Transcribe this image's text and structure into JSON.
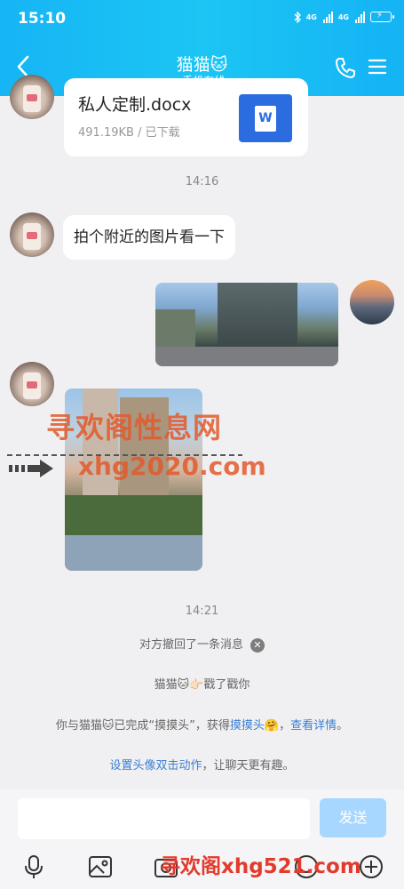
{
  "status_bar": {
    "time": "15:10",
    "network_1": "4G",
    "network_2": "4G"
  },
  "header": {
    "title": "猫猫🐱",
    "subtitle": "手机在线 ›"
  },
  "messages": {
    "file": {
      "name": "私人定制.docx",
      "meta": "491.19KB / 已下载",
      "icon_letter": "W"
    },
    "time_1": "14:16",
    "text_1": "拍个附近的图片看一下",
    "time_2": "14:21",
    "recall_notice": "对方撤回了一条消息",
    "poke_notice": "猫猫🐱👉🏻戳了戳你",
    "achievement_prefix": "你与猫猫🐱已完成“摸摸头”，获得",
    "achievement_link": "摸摸头",
    "achievement_sep": "🤗，",
    "achievement_details": "查看详情",
    "achievement_end": "。",
    "setting_link": "设置头像双击动作",
    "setting_suffix": "，让聊天更有趣。"
  },
  "watermarks": {
    "line_1": "寻欢阁性息网",
    "line_2": "xhg2020.com",
    "line_3": "寻欢阁xhg521.com"
  },
  "input_bar": {
    "send_label": "发送"
  },
  "colors": {
    "header_blue": "#1cc5f4",
    "link_blue": "#3b7fd1",
    "send_disabled": "#a7d7ff",
    "watermark": "#e35a2c"
  }
}
